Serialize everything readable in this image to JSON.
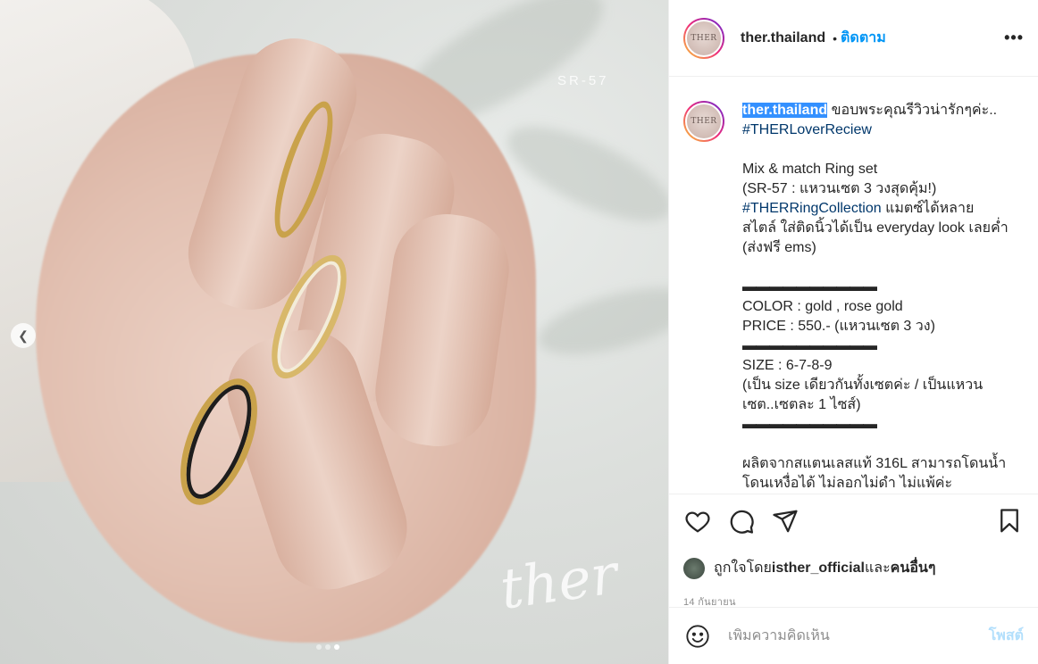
{
  "photo": {
    "label": "SR-57",
    "watermark": "ther",
    "carousel": {
      "count": 3,
      "active": 3
    }
  },
  "header": {
    "avatar_text": "THER",
    "username": "ther.thailand",
    "separator": "•",
    "follow_label": "ติดตาม",
    "more_label": "•••"
  },
  "caption": {
    "avatar_text": "THER",
    "username": "ther.thailand",
    "line1_rest": "ขอบพระคุณรีวิวน่ารักๆค่ะ..",
    "hashtag1": "#THERLoverReciew",
    "p1": "Mix & match Ring set",
    "p2": "(SR-57 : แหวนเซต 3 วงสุดคุ้ม!)",
    "hashtag2": "#THERRingCollection",
    "p3_rest": " แมตซ์ได้หลาย สไตล์ ใส่ติดนิ้วได้เป็น everyday look เลยค่ำ (ส่งฟรี ems)",
    "divider": "▬▬▬▬▬▬▬▬▬▬",
    "color": "COLOR : gold , rose gold",
    "price": "PRICE : 550.- (แหวนเซต 3 วง)",
    "size": "SIZE : 6-7-8-9",
    "size_note": "(เป็น size เดียวกันทั้งเซตค่ะ / เป็นแหวนเซต..เซตละ 1 ไซส์)",
    "material": "ผลิตจากสแตนเลสแท้ 316L สามารถโดนน้ำ โดนเหงื่อได้ ไม่ลอกไม่ดำ ไม่แพ้ค่ะ"
  },
  "actions": {
    "like_icon": "heart-icon",
    "comment_icon": "comment-icon",
    "share_icon": "paper-plane-icon",
    "save_icon": "bookmark-icon"
  },
  "likes": {
    "prefix": "ถูกใจโดย ",
    "user": "isther_official",
    "middle": " และ ",
    "others": "คนอื่นๆ"
  },
  "date": "14 กันยายน",
  "comment_box": {
    "placeholder": "เพิ่มความคิดเห็น",
    "post_label": "โพสต์"
  }
}
